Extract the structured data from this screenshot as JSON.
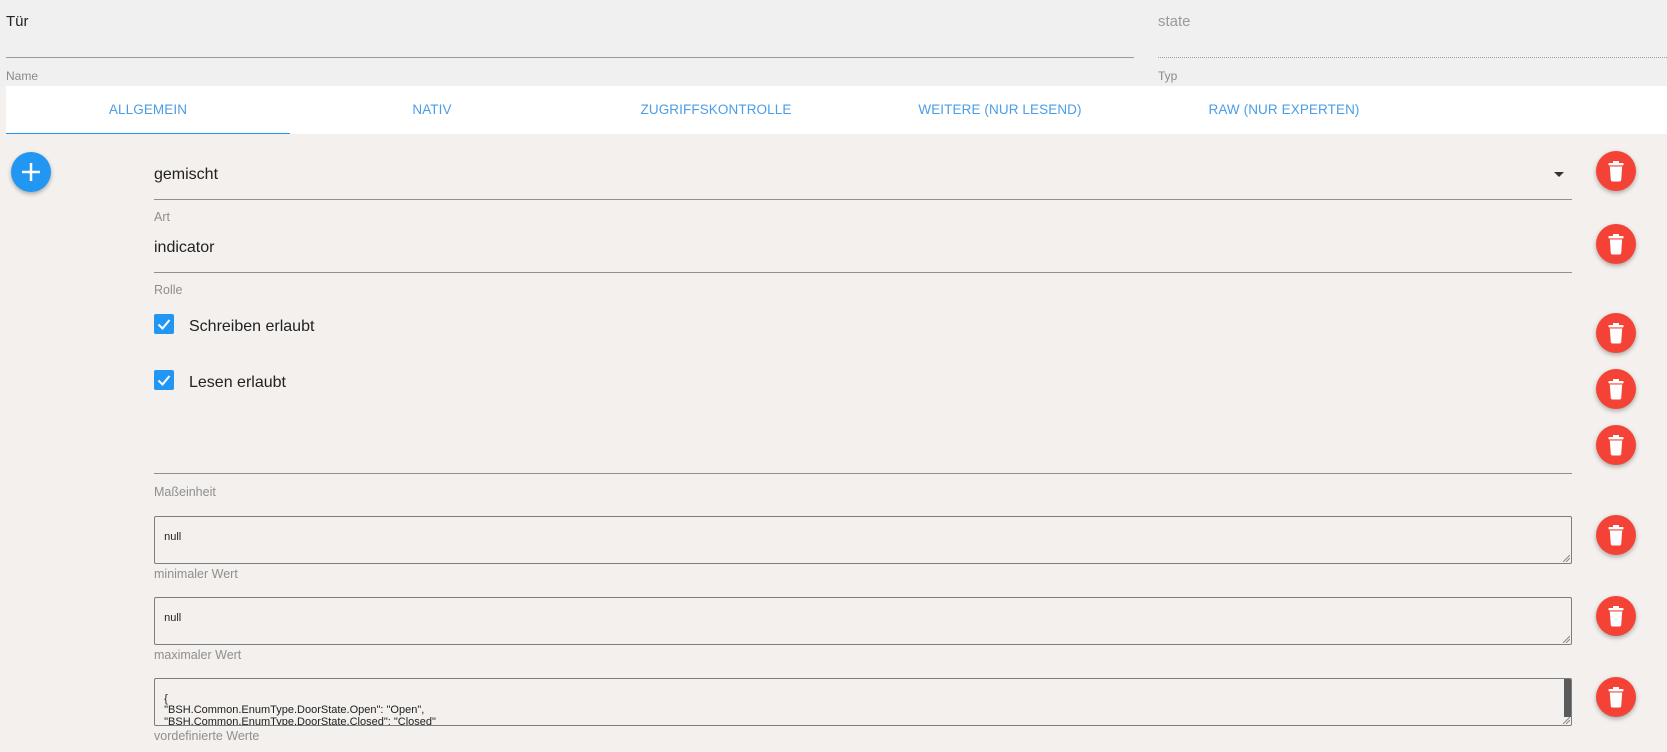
{
  "header": {
    "name_value": "Tür",
    "name_label": "Name",
    "type_value": "state",
    "type_label": "Typ"
  },
  "tabs": [
    {
      "label": "ALLGEMEIN",
      "active": true
    },
    {
      "label": "NATIV",
      "active": false
    },
    {
      "label": "ZUGRIFFSKONTROLLE",
      "active": false
    },
    {
      "label": "WEITERE (NUR LESEND)",
      "active": false
    },
    {
      "label": "RAW (NUR EXPERTEN)",
      "active": false
    }
  ],
  "form": {
    "art": {
      "value": "gemischt",
      "label": "Art"
    },
    "rolle": {
      "value": "indicator",
      "label": "Rolle"
    },
    "write": {
      "label": "Schreiben erlaubt",
      "checked": true
    },
    "read": {
      "label": "Lesen erlaubt",
      "checked": true
    },
    "unit": {
      "value": "",
      "label": "Maßeinheit"
    },
    "min": {
      "value": "null",
      "label": "minimaler Wert"
    },
    "max": {
      "value": "null",
      "label": "maximaler Wert"
    },
    "states": {
      "value": "{\n  \"BSH.Common.EnumType.DoorState.Open\": \"Open\",\n  \"BSH.Common.EnumType.DoorState.Closed\": \"Closed\"\n}",
      "label": "vordefinierte Werte"
    }
  },
  "icons": {
    "add": "plus-icon",
    "delete": "trash-icon",
    "checkbox": "check-icon",
    "dropdown": "caret-down-icon"
  },
  "colors": {
    "primary": "#2196f3",
    "danger": "#f44336",
    "background": "#f3f0ed"
  }
}
